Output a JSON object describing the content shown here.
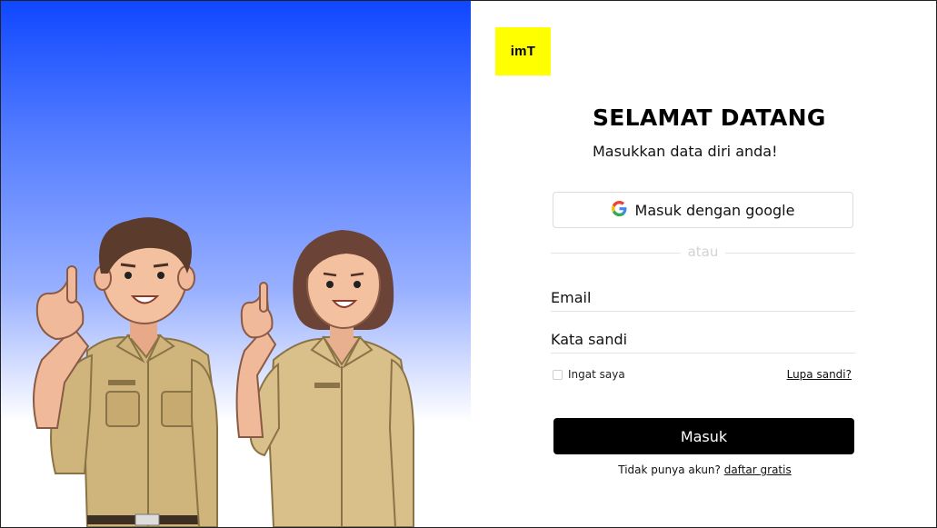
{
  "logo": {
    "brand": "imT",
    "tagline": ""
  },
  "heading": {
    "title": "SELAMAT DATANG",
    "subtitle": "Masukkan data diri anda!"
  },
  "google": {
    "label": "Masuk dengan google"
  },
  "divider": {
    "text": "atau"
  },
  "form": {
    "email_placeholder": "Email",
    "password_placeholder": "Kata sandi",
    "remember_label": "Ingat saya",
    "forgot_label": "Lupa sandi?",
    "submit_label": "Masuk"
  },
  "signup": {
    "prompt": "Tidak punya akun?",
    "link": "daftar gratis"
  },
  "colors": {
    "accent": "#ffff00",
    "hero_top": "#0f47ff",
    "button": "#000000",
    "uniform": "#cfb57c"
  }
}
